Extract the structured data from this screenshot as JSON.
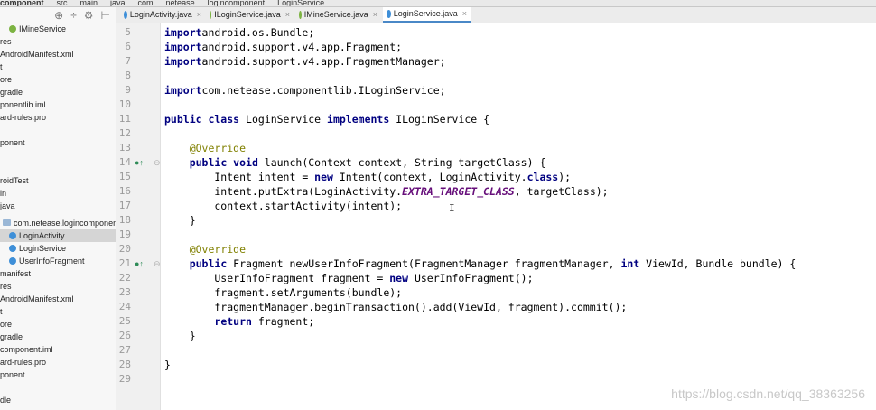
{
  "breadcrumbs": [
    "component",
    "src",
    "main",
    "java",
    "com",
    "netease",
    "logincomponent",
    "LoginService"
  ],
  "project_tree": [
    {
      "label": "IMineService",
      "icon": "green"
    },
    {
      "label": "res",
      "icon": ""
    },
    {
      "label": "AndroidManifest.xml",
      "icon": ""
    },
    {
      "label": "t",
      "icon": ""
    },
    {
      "label": "ore",
      "icon": ""
    },
    {
      "label": "gradle",
      "icon": ""
    },
    {
      "label": "ponentlib.iml",
      "icon": ""
    },
    {
      "label": "ard-rules.pro",
      "icon": ""
    },
    {
      "label": "",
      "icon": ""
    },
    {
      "label": "ponent",
      "icon": ""
    },
    {
      "label": "",
      "icon": ""
    },
    {
      "label": "",
      "icon": ""
    },
    {
      "label": "roidTest",
      "icon": ""
    },
    {
      "label": "in",
      "icon": ""
    },
    {
      "label": "java",
      "icon": ""
    },
    {
      "label": "com.netease.logincomponent",
      "icon": "folder"
    },
    {
      "label": "LoginActivity",
      "icon": "blue",
      "selected": true
    },
    {
      "label": "LoginService",
      "icon": "blue"
    },
    {
      "label": "UserInfoFragment",
      "icon": "blue"
    },
    {
      "label": "manifest",
      "icon": ""
    },
    {
      "label": "res",
      "icon": ""
    },
    {
      "label": "AndroidManifest.xml",
      "icon": ""
    },
    {
      "label": "t",
      "icon": ""
    },
    {
      "label": "ore",
      "icon": ""
    },
    {
      "label": "gradle",
      "icon": ""
    },
    {
      "label": "component.iml",
      "icon": ""
    },
    {
      "label": "ard-rules.pro",
      "icon": ""
    },
    {
      "label": "ponent",
      "icon": ""
    },
    {
      "label": "",
      "icon": ""
    },
    {
      "label": "dle",
      "icon": ""
    }
  ],
  "tabs": [
    {
      "label": "LoginActivity.java",
      "icon": "blue"
    },
    {
      "label": "ILoginService.java",
      "icon": "green"
    },
    {
      "label": "IMineService.java",
      "icon": "green"
    },
    {
      "label": "LoginService.java",
      "icon": "blue",
      "active": true
    }
  ],
  "code_lines": [
    {
      "n": "5",
      "tokens": [
        [
          "kw",
          "import"
        ],
        [
          "",
          "android.os.Bundle;"
        ]
      ]
    },
    {
      "n": "6",
      "tokens": [
        [
          "kw",
          "import"
        ],
        [
          "",
          "android.support.v4.app.Fragment;"
        ]
      ]
    },
    {
      "n": "7",
      "tokens": [
        [
          "kw",
          "import"
        ],
        [
          "",
          "android.support.v4.app.FragmentManager;"
        ]
      ]
    },
    {
      "n": "8",
      "tokens": []
    },
    {
      "n": "9",
      "tokens": [
        [
          "kw",
          "import"
        ],
        [
          "",
          "com.netease.componentlib.ILoginService;"
        ]
      ]
    },
    {
      "n": "10",
      "tokens": []
    },
    {
      "n": "11",
      "tokens": [
        [
          "kw",
          "public class"
        ],
        [
          "",
          " LoginService "
        ],
        [
          "kw",
          "implements"
        ],
        [
          "",
          " ILoginService {"
        ]
      ]
    },
    {
      "n": "12",
      "tokens": []
    },
    {
      "n": "13",
      "tokens": [
        [
          "",
          "    "
        ],
        [
          "an",
          "@Override"
        ]
      ]
    },
    {
      "n": "14",
      "tokens": [
        [
          "",
          "    "
        ],
        [
          "kw",
          "public void"
        ],
        [
          "",
          " launch(Context context, String targetClass) {"
        ]
      ]
    },
    {
      "n": "15",
      "tokens": [
        [
          "",
          "        Intent intent = "
        ],
        [
          "kw",
          "new"
        ],
        [
          "",
          " Intent(context, LoginActivity."
        ],
        [
          "kw",
          "class"
        ],
        [
          "",
          ");"
        ]
      ]
    },
    {
      "n": "16",
      "tokens": [
        [
          "",
          "        intent.putExtra(LoginActivity."
        ],
        [
          "st",
          "EXTRA_TARGET_CLASS"
        ],
        [
          "",
          ", targetClass);"
        ]
      ]
    },
    {
      "n": "17",
      "tokens": [
        [
          "",
          "        context.startActivity(intent);"
        ]
      ]
    },
    {
      "n": "18",
      "tokens": [
        [
          "",
          "    }"
        ]
      ]
    },
    {
      "n": "19",
      "tokens": []
    },
    {
      "n": "20",
      "tokens": [
        [
          "",
          "    "
        ],
        [
          "an",
          "@Override"
        ]
      ]
    },
    {
      "n": "21",
      "tokens": [
        [
          "",
          "    "
        ],
        [
          "kw",
          "public"
        ],
        [
          "",
          " Fragment newUserInfoFragment(FragmentManager fragmentManager, "
        ],
        [
          "kw",
          "int"
        ],
        [
          "",
          " ViewId, Bundle bundle) {"
        ]
      ]
    },
    {
      "n": "22",
      "tokens": [
        [
          "",
          "        UserInfoFragment fragment = "
        ],
        [
          "kw",
          "new"
        ],
        [
          "",
          " UserInfoFragment();"
        ]
      ]
    },
    {
      "n": "23",
      "tokens": [
        [
          "",
          "        fragment.setArguments(bundle);"
        ]
      ]
    },
    {
      "n": "24",
      "tokens": [
        [
          "",
          "        fragmentManager.beginTransaction().add(ViewId, fragment).commit();"
        ]
      ]
    },
    {
      "n": "25",
      "tokens": [
        [
          "",
          "        "
        ],
        [
          "kw",
          "return"
        ],
        [
          "",
          " fragment;"
        ]
      ]
    },
    {
      "n": "26",
      "tokens": [
        [
          "",
          "    }"
        ]
      ]
    },
    {
      "n": "27",
      "tokens": []
    },
    {
      "n": "28",
      "tokens": [
        [
          "",
          "}"
        ]
      ]
    },
    {
      "n": "29",
      "tokens": []
    }
  ],
  "watermark": "https://blog.csdn.net/qq_38363256"
}
